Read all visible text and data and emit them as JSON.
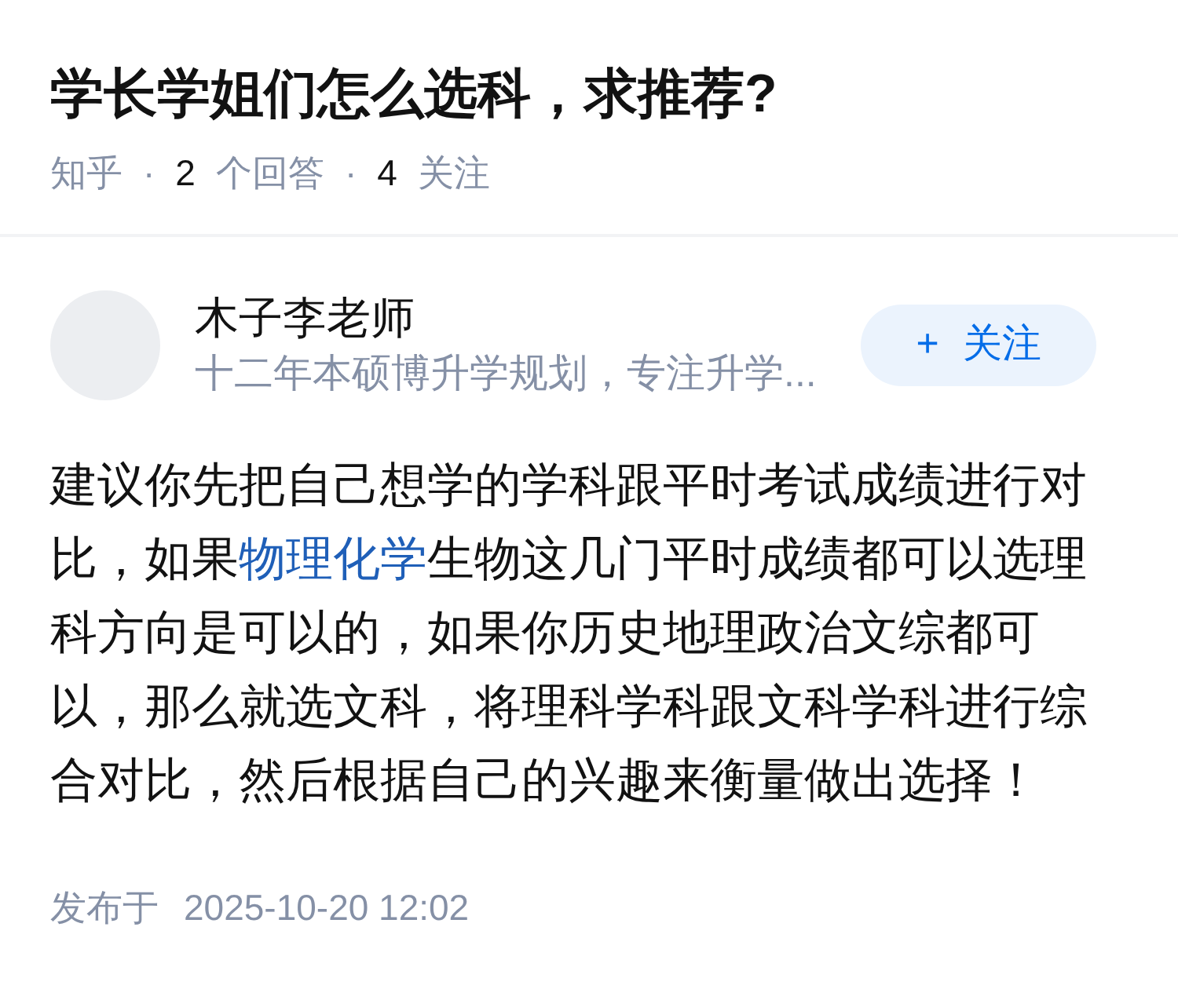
{
  "question": {
    "title": "学长学姐们怎么选科，求推荐?",
    "meta": [
      {
        "kind": "source",
        "text": "知乎"
      },
      {
        "kind": "separator",
        "text": "·"
      },
      {
        "kind": "stat",
        "number": "2",
        "label": "个回答"
      },
      {
        "kind": "separator",
        "text": "·"
      },
      {
        "kind": "stat",
        "number": "4",
        "label": "关注"
      }
    ]
  },
  "answer": {
    "author": {
      "name": "木子李老师",
      "bio": "十二年本硕博升学规划，专注升学..."
    },
    "follow_button": {
      "label": "+ 关注"
    },
    "content": [
      {
        "kind": "text",
        "text": "建议你先把自己想学的学科跟平时考试成绩进行对比，如果"
      },
      {
        "kind": "link",
        "text": "物理化学"
      },
      {
        "kind": "text",
        "text": "生物这几门平时成绩都可以选理科方向是可以的，如果你历史地理政治文综都可以，那么就选文科，将理科学科跟文科学科进行综合对比，然后根据自己的兴趣来衡量做出选择！"
      }
    ],
    "published": {
      "label": "发布于",
      "time": "2025-10-20 12:02"
    }
  }
}
